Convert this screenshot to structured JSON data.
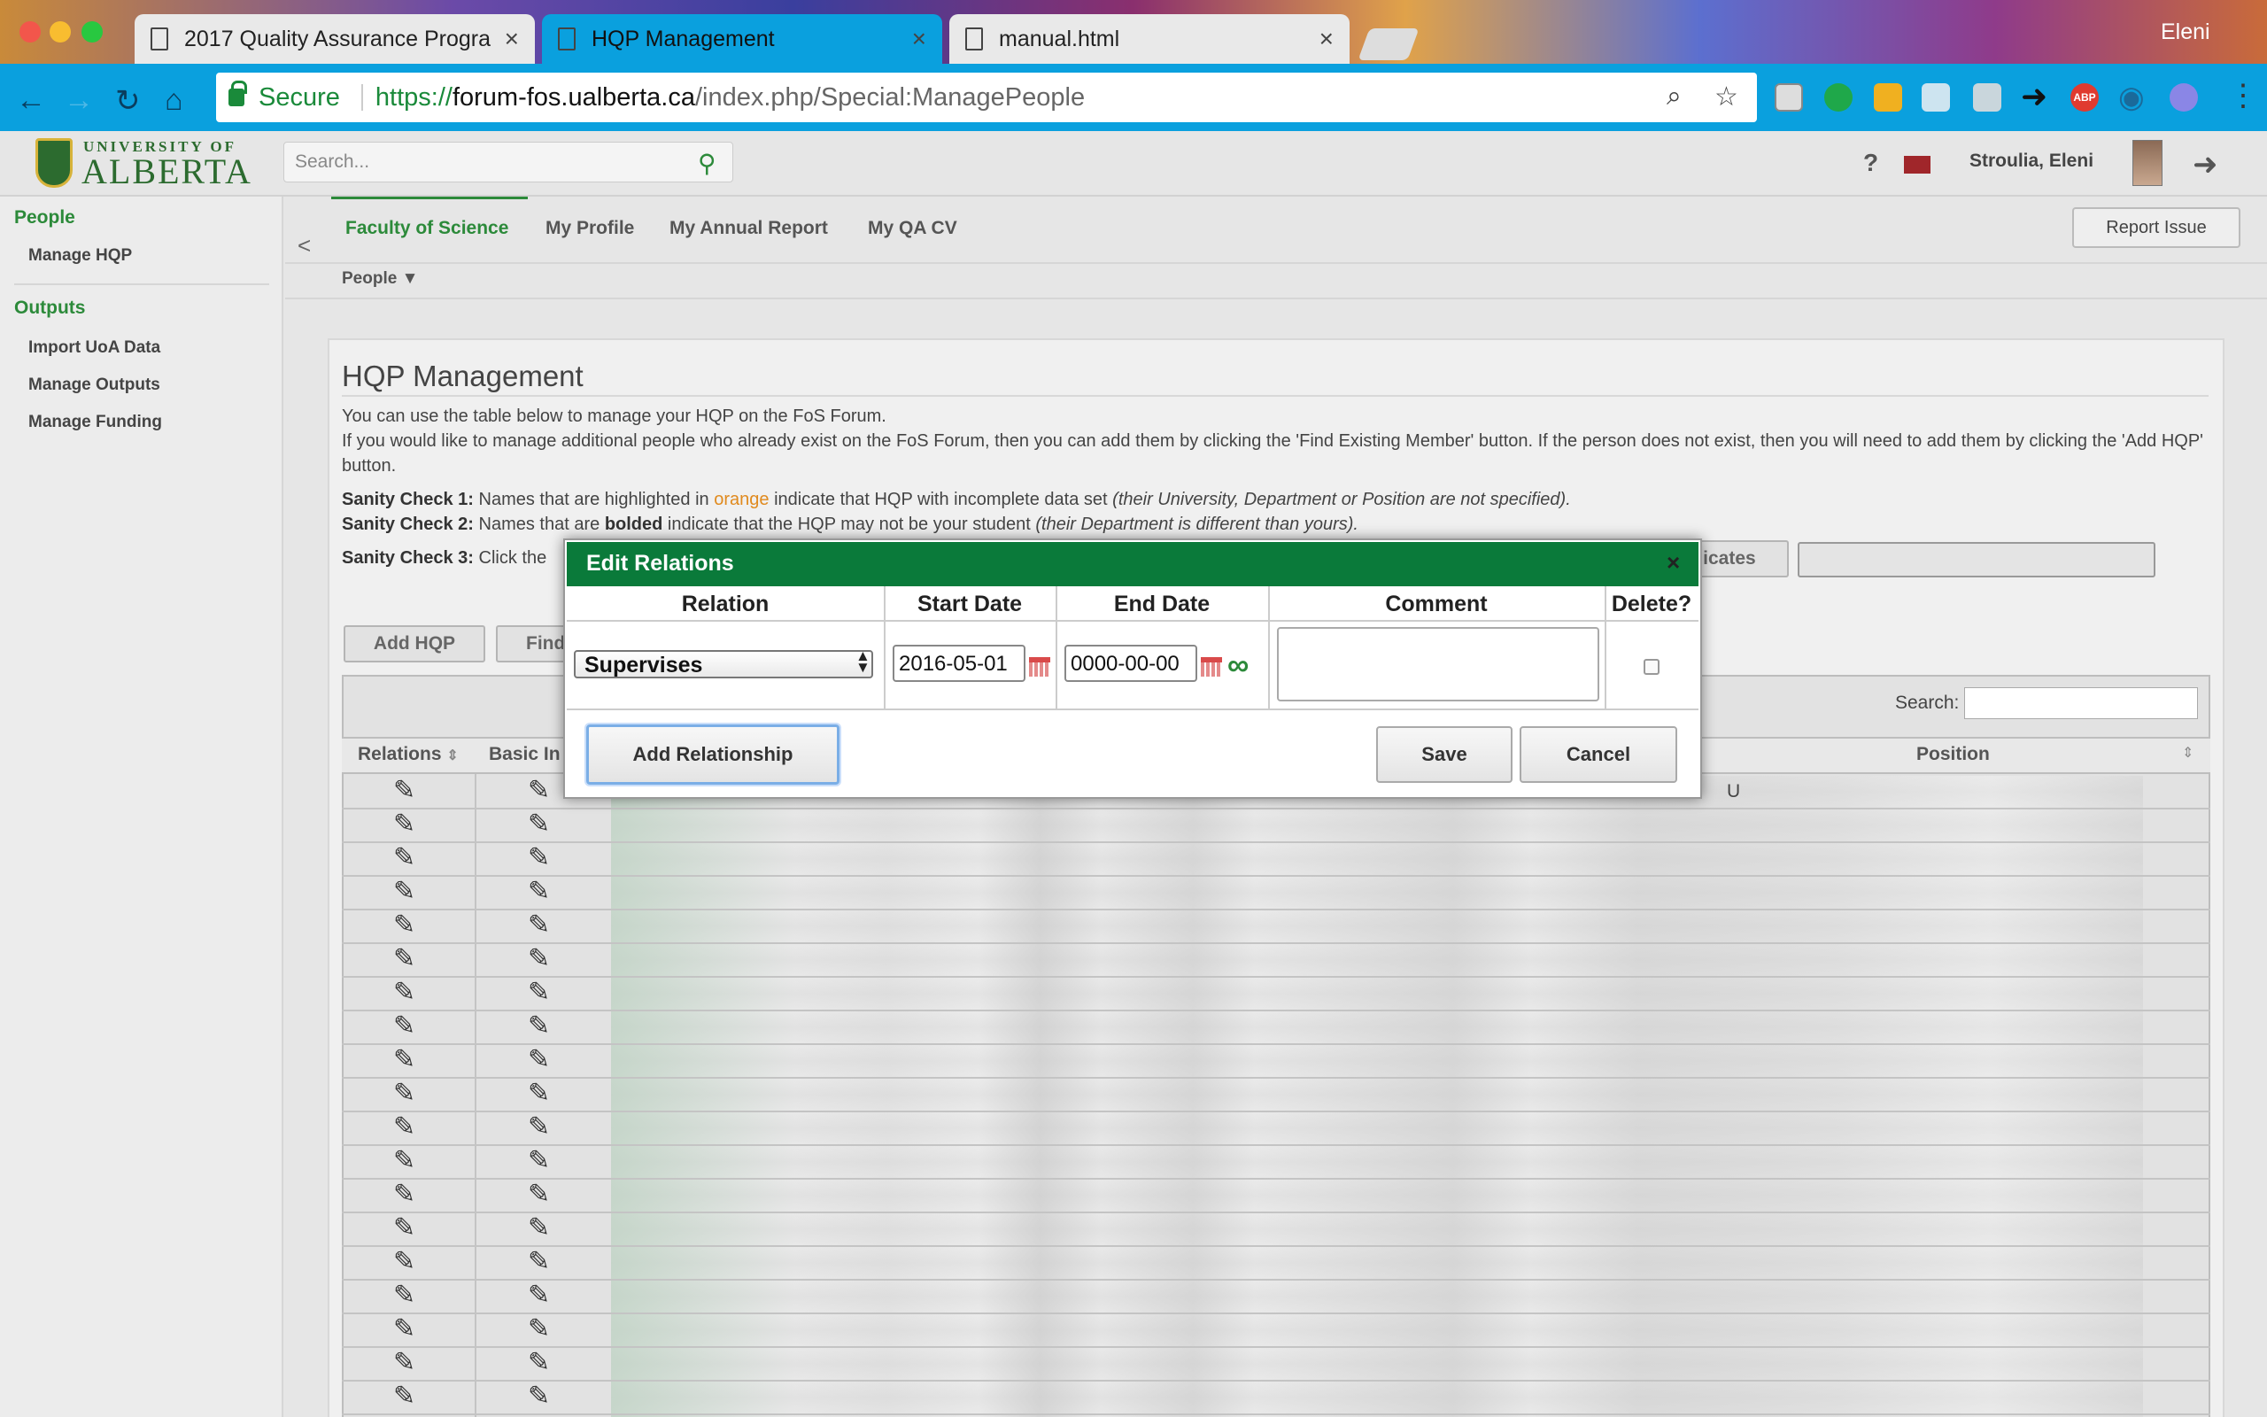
{
  "browser": {
    "tabs": [
      {
        "title": "2017 Quality Assurance Progra",
        "close": "×"
      },
      {
        "title": "HQP Management",
        "close": "×"
      },
      {
        "title": "manual.html",
        "close": "×"
      }
    ],
    "profile_label": "Eleni",
    "secure_label": "Secure",
    "url": {
      "scheme": "https://",
      "host": "forum-fos.ualberta.ca",
      "path": "/index.php/Special:ManagePeople"
    },
    "extensions": [
      "abp-icon",
      "rss-icon",
      "drive-icon",
      "eye-icon"
    ]
  },
  "header": {
    "logo_top": "UNIVERSITY OF",
    "logo_main": "ALBERTA",
    "search_placeholder": "Search...",
    "help": "?",
    "user_name": "Stroulia, Eleni"
  },
  "sidebar": {
    "people_heading": "People",
    "people_items": [
      "Manage HQP"
    ],
    "outputs_heading": "Outputs",
    "outputs_items": [
      "Import UoA Data",
      "Manage Outputs",
      "Manage Funding"
    ]
  },
  "topnav": {
    "collapse": "<",
    "items": [
      "Faculty of Science",
      "My Profile",
      "My Annual Report",
      "My QA CV"
    ],
    "report_issue": "Report Issue",
    "submenu": "People ▼"
  },
  "main": {
    "title": "HQP Management",
    "intro1": "You can use the table below to manage your HQP on the FoS Forum.",
    "intro2": "If you would like to manage additional people who already exist on the FoS Forum, then you can add them by clicking the 'Find Existing Member' button. If the person does not exist, then you will need to add them by clicking the 'Add HQP' button.",
    "check1_label": "Sanity Check 1:",
    "check1_pre": "Names that are highlighted in",
    "check1_orange": "orange",
    "check1_post": "indicate that HQP with incomplete data set",
    "check1_italic": "(their University, Department or Position are not specified).",
    "check2_label": "Sanity Check 2:",
    "check2_pre": "Names that are",
    "check2_bold": "bolded",
    "check2_post": "indicate that the HQP may not be your student",
    "check2_italic": "(their Department is different than yours).",
    "check3_label": "Sanity Check 3:",
    "check3_text": "Click the",
    "duplicates_btn": "licates",
    "add_hqp": "Add HQP",
    "find_btn": "Find"
  },
  "table": {
    "search_label": "Search:",
    "columns": [
      "Relations",
      "Basic In",
      "Position"
    ],
    "sort_glyph": "⇕",
    "position_first_cell": "U",
    "row_count": 19
  },
  "modal": {
    "title": "Edit Relations",
    "close": "×",
    "columns": [
      "Relation",
      "Start Date",
      "End Date",
      "Comment",
      "Delete?"
    ],
    "relation_value": "Supervises",
    "relation_arrows": "▲▼",
    "start_date": "2016-05-01",
    "end_date": "0000-00-00",
    "infinity": "∞",
    "comment": "",
    "delete_checked": false,
    "add_relationship": "Add Relationship",
    "save": "Save",
    "cancel": "Cancel"
  },
  "colors": {
    "chrome_blue": "#0aa0de",
    "ua_green": "#2c8a3a",
    "modal_header": "#0a7a3a",
    "orange": "#e08a1e"
  }
}
